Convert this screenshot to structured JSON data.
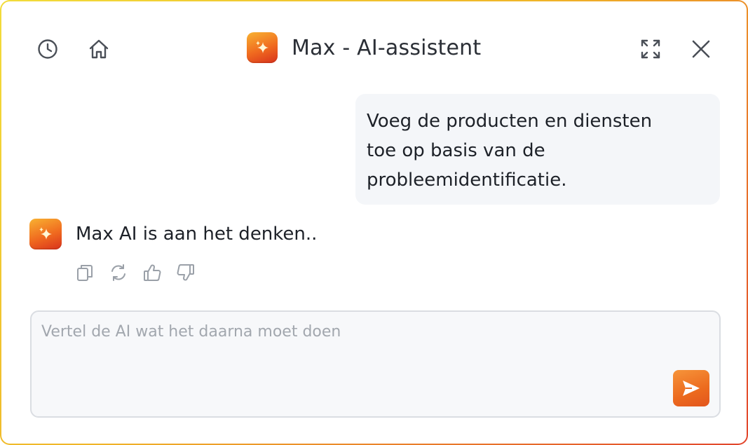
{
  "header": {
    "title": "Max - AI-assistent",
    "left_icons": [
      "history-icon",
      "home-icon"
    ],
    "right_icons": [
      "expand-icon",
      "close-icon"
    ]
  },
  "conversation": {
    "user_message_lines": [
      "Voeg de producten en diensten",
      "toe op basis van de",
      "probleemidentificatie."
    ],
    "ai_status": "Max AI is aan het denken..",
    "ai_actions": [
      "copy-icon",
      "regenerate-icon",
      "thumbs-up-icon",
      "thumbs-down-icon"
    ]
  },
  "composer": {
    "placeholder": "Vertel de AI wat het daarna moet doen",
    "value": "",
    "send_icon": "send-icon"
  },
  "colors": {
    "accent": "#ec6a1e",
    "border_gradient_start": "#f2dc3a",
    "border_gradient_end": "#e2452c",
    "bubble_bg": "#f4f6f9"
  }
}
